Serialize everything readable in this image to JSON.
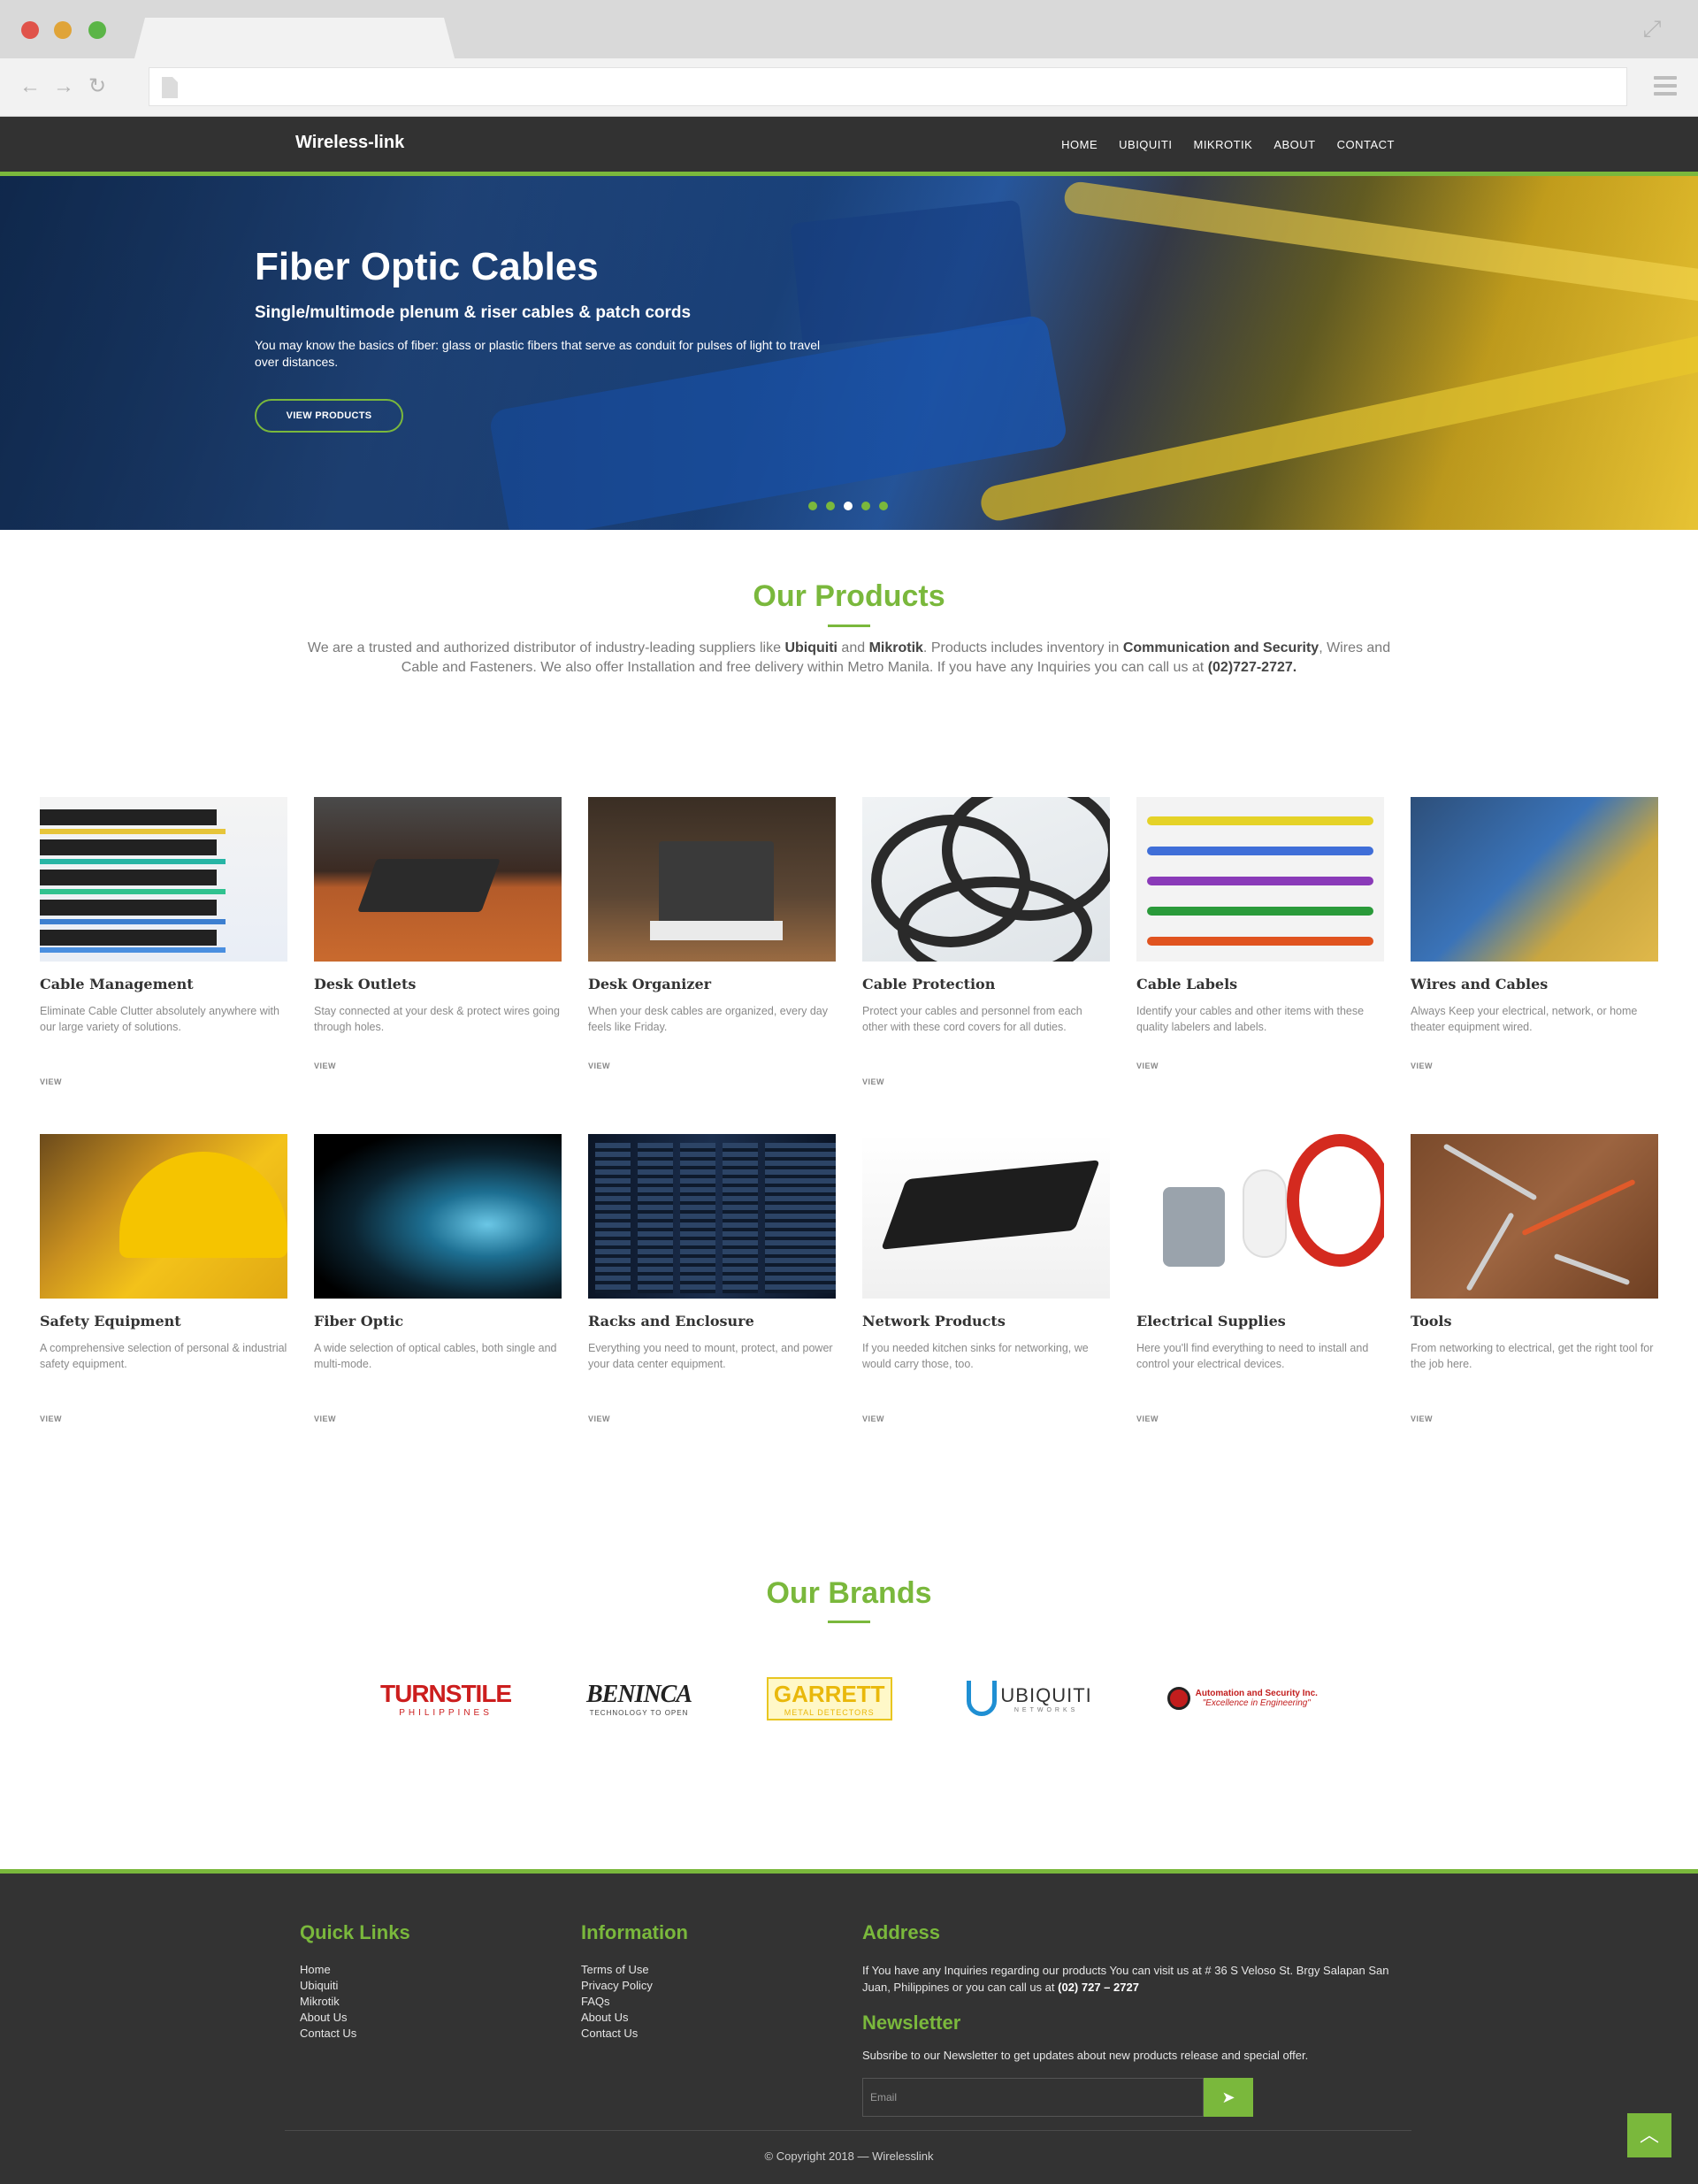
{
  "site": {
    "brand": "Wireless-link",
    "nav": [
      "HOME",
      "UBIQUITI",
      "MIKROTIK",
      "ABOUT",
      "CONTACT"
    ]
  },
  "hero": {
    "title": "Fiber Optic Cables",
    "subtitle": "Single/multimode plenum & riser cables & patch cords",
    "description": "You may know the basics of fiber: glass or plastic fibers that serve as conduit for pulses of light to travel over distances.",
    "button": "VIEW PRODUCTS",
    "slides_total": 5,
    "active_slide": 3
  },
  "products": {
    "title": "Our Products",
    "intro": {
      "p1": "We are a trusted and authorized distributor of industry-leading suppliers like ",
      "b1": "Ubiquiti",
      "p2": " and ",
      "b2": "Mikrotik",
      "p3": ". Products includes inventory in ",
      "b3": "Communication and Security",
      "p4": ", Wires and Cable and Fasteners. We also offer Installation and free delivery within Metro Manila. If you have any Inquiries you can call us at ",
      "phone": "(02)727-2727."
    },
    "items": [
      {
        "name": "Cable Management",
        "desc": "Eliminate Cable Clutter absolutely anywhere with our large variety of solutions.",
        "link": "VIEW"
      },
      {
        "name": "Desk Outlets",
        "desc": "Stay connected at your desk & protect wires going through holes.",
        "link": "VIEW"
      },
      {
        "name": "Desk Organizer",
        "desc": "When your desk cables are organized, every day feels like Friday.",
        "link": "VIEW"
      },
      {
        "name": "Cable Protection",
        "desc": "Protect your cables and personnel from each other with these cord covers for all duties.",
        "link": "VIEW"
      },
      {
        "name": "Cable Labels",
        "desc": "Identify your cables and other items with these quality labelers and labels.",
        "link": "VIEW"
      },
      {
        "name": "Wires and Cables",
        "desc": "Always Keep your electrical, network, or home theater equipment wired.",
        "link": "VIEW"
      },
      {
        "name": "Safety Equipment",
        "desc": "A comprehensive selection of personal & industrial safety equipment.",
        "link": "VIEW"
      },
      {
        "name": "Fiber Optic",
        "desc": "A wide selection of optical cables, both single and multi-mode.",
        "link": "VIEW"
      },
      {
        "name": "Racks and Enclosure",
        "desc": "Everything you need to mount, protect, and power your data center equipment.",
        "link": "VIEW"
      },
      {
        "name": "Network Products",
        "desc": "If you needed kitchen sinks for networking, we would carry those, too.",
        "link": "VIEW"
      },
      {
        "name": "Electrical Supplies",
        "desc": "Here you'll find everything to need to install and control your electrical devices.",
        "link": "VIEW"
      },
      {
        "name": "Tools",
        "desc": "From networking to electrical, get the right tool for the job here.",
        "link": "VIEW"
      }
    ]
  },
  "brands": {
    "title": "Our Brands",
    "logos": {
      "turnstile": {
        "big": "TURNSTILE",
        "small": "PHILIPPINES"
      },
      "beninca": {
        "big": "BENINCA",
        "small": "TECHNOLOGY TO OPEN"
      },
      "garrett": {
        "big": "GARRETT",
        "small": "METAL DETECTORS"
      },
      "ubiquiti": {
        "big": "UBIQUITI",
        "small": "NETWORKS"
      },
      "automation": {
        "big": "Automation and Security Inc.",
        "small": "\"Excellence in Engineering\""
      }
    }
  },
  "footer": {
    "quick_links_title": "Quick Links",
    "quick_links": [
      "Home",
      "Ubiquiti",
      "Mikrotik",
      "About Us",
      "Contact Us"
    ],
    "information_title": "Information",
    "information": [
      "Terms of Use",
      "Privacy Policy",
      "FAQs",
      "About Us",
      "Contact Us"
    ],
    "address_title": "Address",
    "address_text": "If You have any Inquiries regarding our products You can visit us at # 36 S Veloso St. Brgy Salapan San Juan, Philippines or you can call us at ",
    "address_phone": "(02) 727 – 2727",
    "newsletter_title": "Newsletter",
    "newsletter_text": "Subsribe to our Newsletter to get updates about new products release and special offer.",
    "email_placeholder": "Email",
    "copyright": "© Copyright 2018 — Wirelesslink"
  },
  "colors": {
    "accent": "#7ab83c",
    "dark": "#333333",
    "nav": "#323232"
  }
}
